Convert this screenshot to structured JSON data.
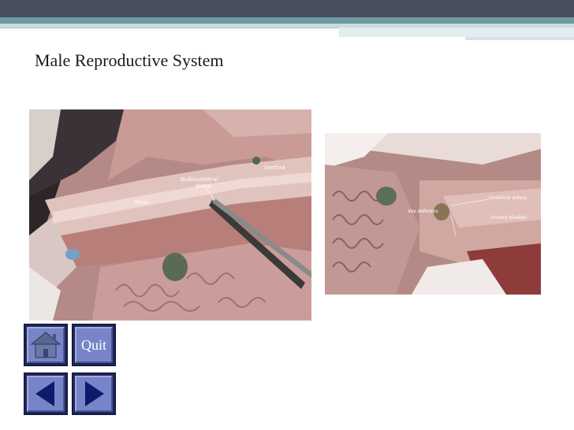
{
  "slide": {
    "title": "Male Reproductive System"
  },
  "figures": {
    "left": {
      "labels": {
        "urethra": "Urethra",
        "bulbourethral_line1": "Bulbourethral",
        "bulbourethral_line2": "gland",
        "penis": "Penis"
      }
    },
    "right": {
      "labels": {
        "umbilical_artery": "Umbilical artery",
        "vas_deferens": "Vas deferens",
        "urinary_bladder": "Urinary bladder"
      }
    }
  },
  "nav": {
    "home_icon": "home-icon",
    "quit_label": "Quit",
    "prev_icon": "triangle-left-icon",
    "next_icon": "triangle-right-icon",
    "button_color": "#7884c8",
    "border_color": "#1d2557"
  }
}
